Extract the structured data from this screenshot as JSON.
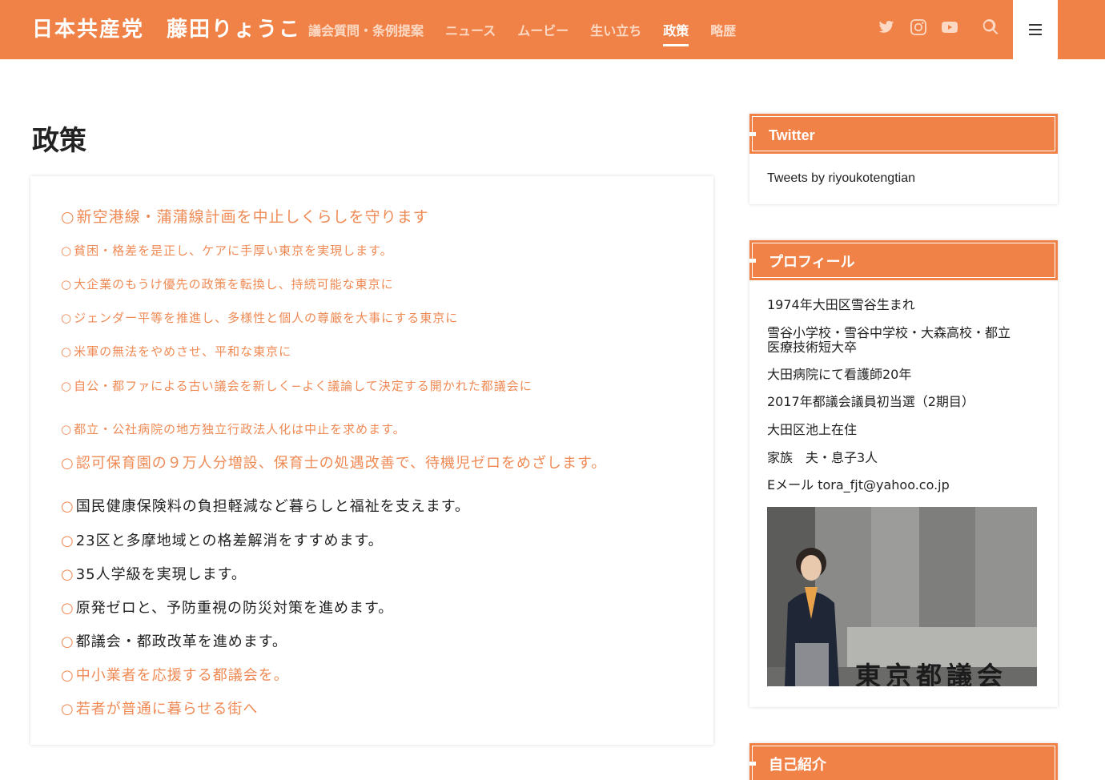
{
  "header": {
    "site_title": "日本共産党　藤田りょうこ",
    "nav": [
      {
        "label": "議会質問・条例提案",
        "active": false
      },
      {
        "label": "ニュース",
        "active": false
      },
      {
        "label": "ムービー",
        "active": false
      },
      {
        "label": "生い立ち",
        "active": false
      },
      {
        "label": "政策",
        "active": true
      },
      {
        "label": "略歴",
        "active": false
      }
    ],
    "icons": [
      "twitter-icon",
      "instagram-icon",
      "youtube-icon",
      "search-icon",
      "menu-icon"
    ]
  },
  "main": {
    "page_title": "政策",
    "policies": [
      {
        "text": "新空港線・蒲蒲線計画を中止しくらしを守ります",
        "color": "orange"
      },
      {
        "text": "貧困・格差を是正し、ケアに手厚い東京を実現します。",
        "color": "orange"
      },
      {
        "text": "大企業のもうけ優先の政策を転換し、持続可能な東京に",
        "color": "orange"
      },
      {
        "text": "ジェンダー平等を推進し、多様性と個人の尊厳を大事にする東京に",
        "color": "orange"
      },
      {
        "text": "米軍の無法をやめさせ、平和な東京に",
        "color": "orange"
      },
      {
        "text": "自公・都ファによる古い議会を新しく−よく議論して決定する開かれた都議会に",
        "color": "orange"
      },
      {
        "text": "都立・公社病院の地方独立行政法人化は中止を求めます。",
        "color": "orange"
      },
      {
        "text": "認可保育園の９万人分増設、保育士の処遇改善で、待機児ゼロをめざします。",
        "color": "orange"
      },
      {
        "text": "国民健康保険料の負担軽減など暮らしと福祉を支えます。",
        "color": "dark"
      },
      {
        "text": "23区と多摩地域との格差解消をすすめます。",
        "color": "dark"
      },
      {
        "text": "35人学級を実現します。",
        "color": "dark"
      },
      {
        "text": "原発ゼロと、予防重視の防災対策を進めます。",
        "color": "dark"
      },
      {
        "text": "都議会・都政改革を進めます。",
        "color": "dark"
      },
      {
        "text": "中小業者を応援する都議会を。",
        "color": "orange"
      },
      {
        "text": "若者が普通に暮らせる街へ",
        "color": "orange"
      }
    ],
    "bullet": "○"
  },
  "sidebar": {
    "twitter": {
      "title": "Twitter",
      "body": "Tweets by riyoukotengtian"
    },
    "profile": {
      "title": "プロフィール",
      "lines": [
        "1974年大田区雪谷生まれ",
        "雪谷小学校・雪谷中学校・大森高校・都立",
        "医療技術短大卒",
        "大田病院にて看護師20年",
        "2017年都議会議員初当選（2期目）",
        "大田区池上在住",
        "家族　夫・息子3人",
        "Eメール tora_fjt@yahoo.co.jp"
      ],
      "photo_sign": "東京都議会"
    },
    "intro": {
      "title": "自己紹介"
    }
  },
  "colors": {
    "header_bg": "#f08248",
    "accent_text": "#ef8a55",
    "nav_inactive": "#fbd9c4"
  }
}
